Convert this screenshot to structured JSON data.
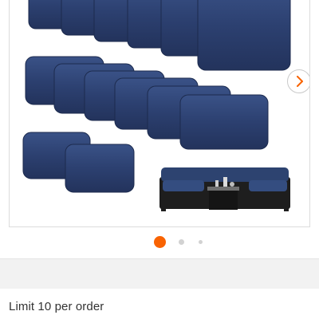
{
  "gallery": {
    "image_description_icon": "cushion-set-product-image",
    "next_icon": "chevron-right-icon",
    "slides": [
      {
        "active": true
      },
      {
        "active": false
      },
      {
        "active": false
      }
    ],
    "colors": {
      "cushion": "#2b3f6e",
      "active_dot": "#f96302",
      "inactive_dot": "#d2d2d2"
    }
  },
  "purchase": {
    "limit_text": "Limit 10 per order"
  }
}
